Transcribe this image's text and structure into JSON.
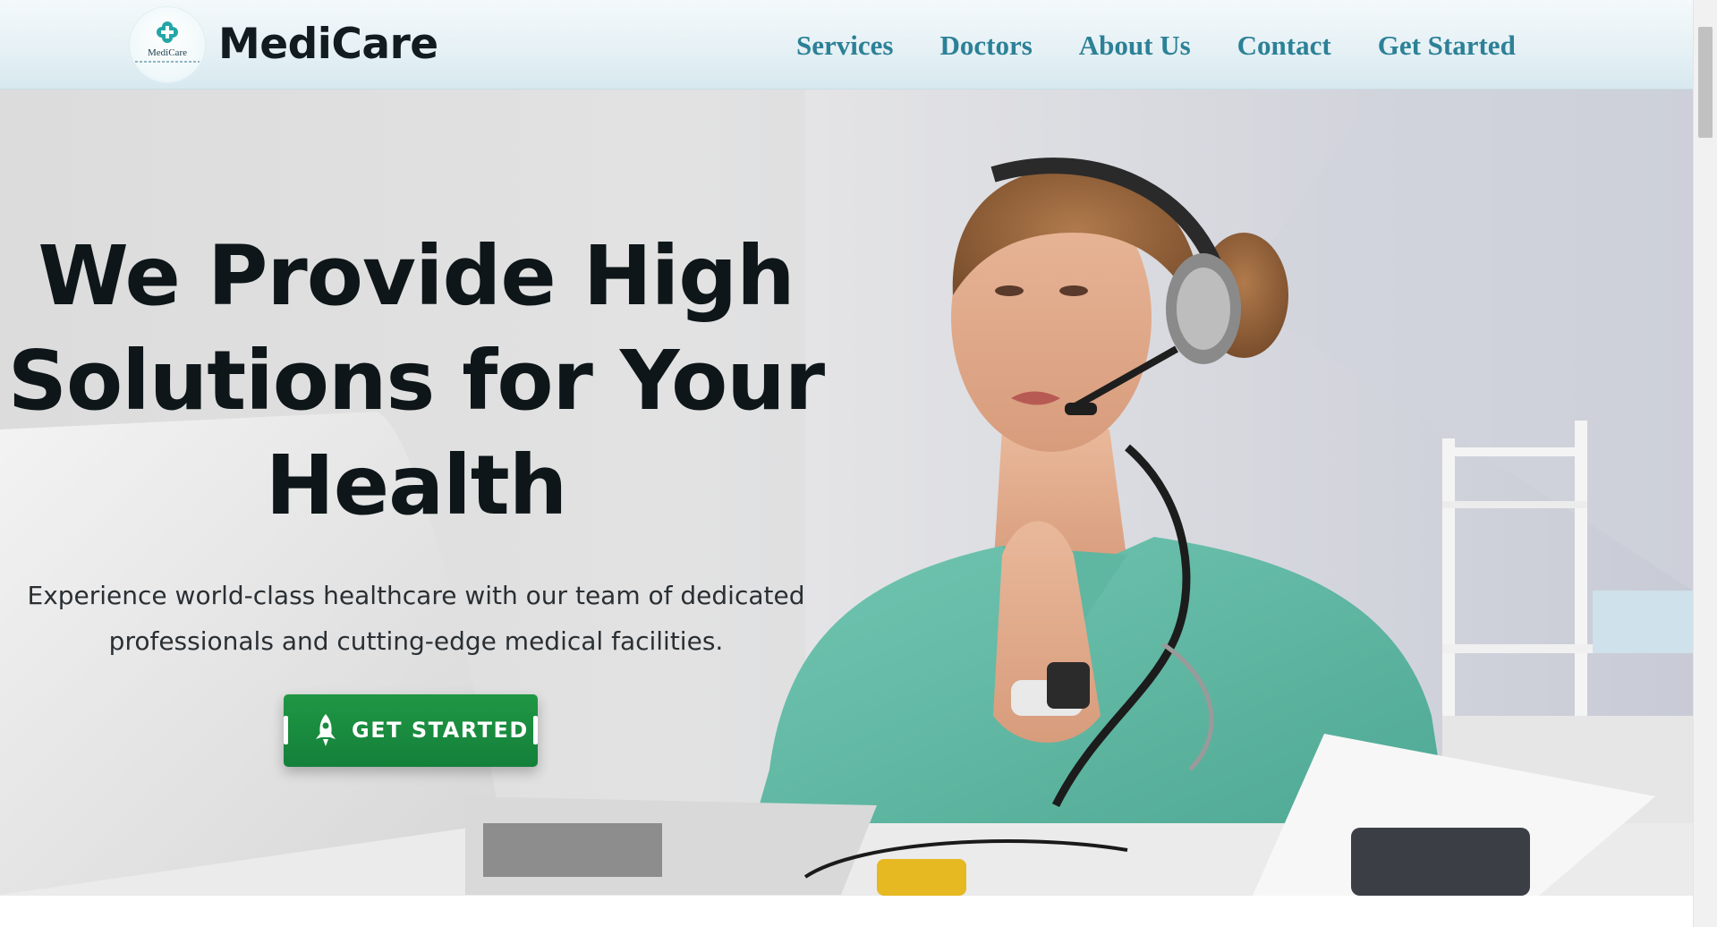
{
  "brand": {
    "name": "MediCare",
    "logo_text": "MediCare",
    "logo_icon": "medical-cross-icon"
  },
  "nav": {
    "items": [
      {
        "label": "Services"
      },
      {
        "label": "Doctors"
      },
      {
        "label": "About Us"
      },
      {
        "label": "Contact"
      },
      {
        "label": "Get Started"
      }
    ]
  },
  "hero": {
    "title": "We Provide High Solutions for Your Health",
    "subtitle": "Experience world-class healthcare with our team of dedicated professionals and cutting-edge medical facilities.",
    "cta_label": "GET STARTED",
    "cta_icon": "rocket-icon",
    "image": "doctor-with-headset-photo"
  },
  "colors": {
    "nav_link": "#2c8197",
    "brand_text": "#111b20",
    "cta_green": "#1a8b3f",
    "title_text": "#0e1619",
    "scrub_teal": "#63bca6"
  }
}
